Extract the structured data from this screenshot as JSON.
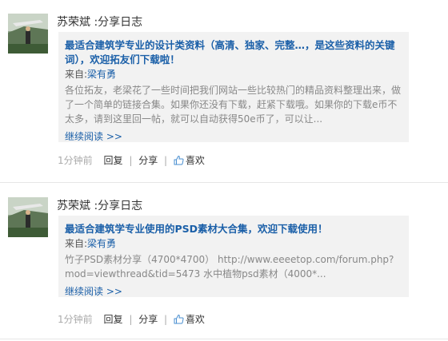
{
  "feed": [
    {
      "author": "苏荣斌",
      "action": ":分享日志",
      "title": "最适合建筑学专业的设计类资料（高清、独家、完整…，是这些资料的关键词），欢迎拓友们下载啦！",
      "from_label": "来自:",
      "from_source": "梁有勇",
      "excerpt": "各位拓友，老梁花了一些时间把我们网站一些比较热门的精品资料整理出来，做了一个简单的链接合集。如果你还没有下载，赶紧下载哦。如果你的下载e币不太多，请到这里回一帖，就可以自动获得50e币了，可以让...",
      "more_label": "继续阅读 >>",
      "time": "1分钟前",
      "reply": "回复",
      "share": "分享",
      "like": "喜欢"
    },
    {
      "author": "苏荣斌",
      "action": ":分享日志",
      "title": "最适合建筑学专业使用的PSD素材大合集，欢迎下载使用！",
      "from_label": "来自:",
      "from_source": "梁有勇",
      "excerpt": "竹子PSD素材分享（4700*4700） http://www.eeeetop.com/forum.php?mod=viewthread&tid=5473 水中植物psd素材（4000*...",
      "more_label": "继续阅读 >>",
      "time": "1分钟前",
      "reply": "回复",
      "share": "分享",
      "like": "喜欢"
    }
  ],
  "colors": {
    "link": "#1a5fa8",
    "card_bg": "#f2f2f2",
    "muted": "#888888"
  },
  "icons": [
    "avatar-photo",
    "thumbs-up-icon"
  ]
}
